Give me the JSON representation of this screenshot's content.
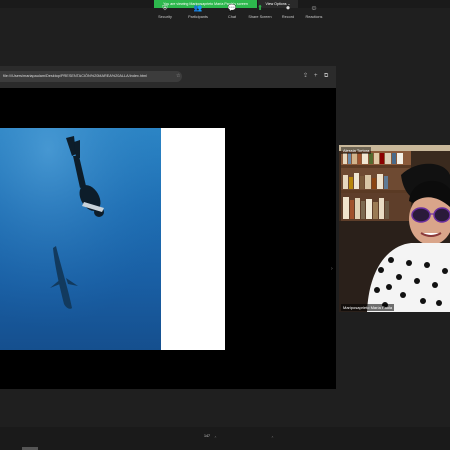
{
  "banner": {
    "text": "You are viewing Mariposaprieto María Paula's screen"
  },
  "view_options": {
    "label": "View Options ⌄"
  },
  "browser": {
    "url": "file:///Users/mariapaulam/Desktop/PRESENTACIÓN%20MAREA%20ALLA/index.html"
  },
  "participant": {
    "top_label": "Alessia Tortora",
    "bottom_label": "Mariposaprieto María Paula"
  },
  "toolbar": {
    "security": "Security",
    "participants": "Participants",
    "participants_count": "147",
    "chat": "Chat",
    "share_screen": "Share Screen",
    "record": "Record",
    "reactions": "Reactions"
  },
  "colors": {
    "banner_green": "#2db84d",
    "ocean_blue": "#1f6fb4",
    "toolbar_bg": "#1a1a1a"
  },
  "icons": [
    "shield-icon",
    "participants-icon",
    "chat-icon",
    "share-screen-icon",
    "record-icon",
    "reactions-icon"
  ]
}
